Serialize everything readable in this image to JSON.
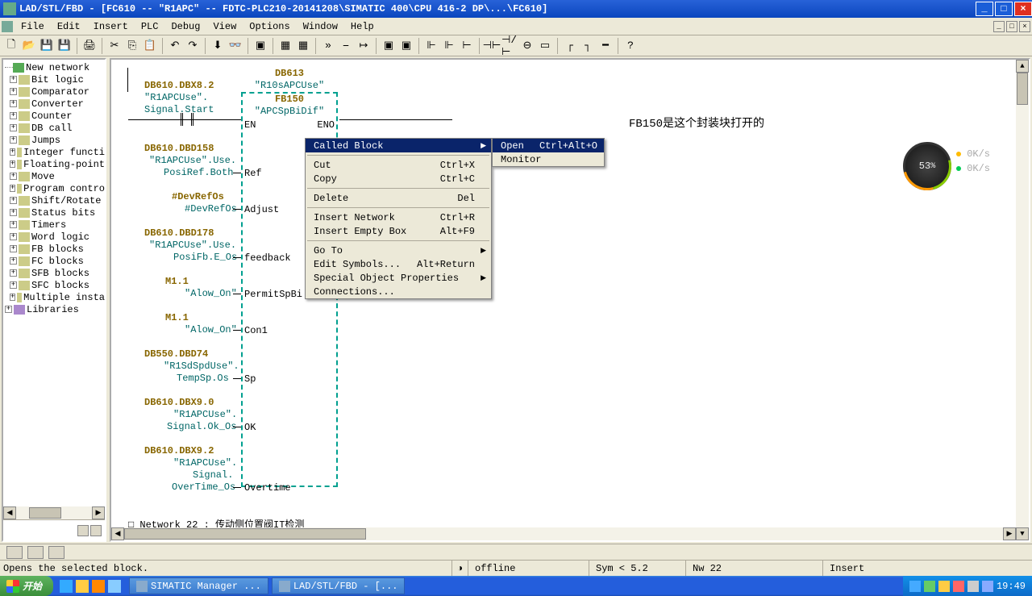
{
  "title": "LAD/STL/FBD  - [FC610 -- \"R1APC\" -- FDTC-PLC210-20141208\\SIMATIC 400\\CPU 416-2 DP\\...\\FC610]",
  "menu": {
    "file": "File",
    "edit": "Edit",
    "insert": "Insert",
    "plc": "PLC",
    "debug": "Debug",
    "view": "View",
    "options": "Options",
    "window": "Window",
    "help": "Help"
  },
  "tree": {
    "items": [
      "New network",
      "Bit logic",
      "Comparator",
      "Converter",
      "Counter",
      "DB call",
      "Jumps",
      "Integer functi",
      "Floating-point",
      "Move",
      "Program contro",
      "Shift/Rotate",
      "Status bits",
      "Timers",
      "Word logic",
      "FB blocks",
      "FC blocks",
      "SFB blocks",
      "SFC blocks",
      "Multiple insta"
    ],
    "libraries": "Libraries"
  },
  "block": {
    "db_header": "DB613",
    "db_name": "\"R10sAPCUse\"",
    "fb_header": "FB150",
    "fb_name": "\"APCSpBiDif\"",
    "en": "EN",
    "eno": "ENO",
    "p0_addr": "DB610.DBX8.2",
    "p0_sym": "\"R1APCUse\".",
    "p0_sym2": "Signal.Start",
    "p1_addr": "DB610.DBD158",
    "p1_sym": "\"R1APCUse\".Use.",
    "p1_sym2": "PosiRef.Both",
    "p1_port": "Ref",
    "p2_addr": "#DevRefOs",
    "p2_sym": "#DevRefOs",
    "p2_port": "Adjust",
    "p3_addr": "DB610.DBD178",
    "p3_sym": "\"R1APCUse\".Use.",
    "p3_sym2": "PosiFb.E_Os",
    "p3_port": "feedback",
    "p4_addr": "M1.1",
    "p4_sym": "\"Alow_On\"",
    "p4_port": "PermitSpBi",
    "p5_addr": "M1.1",
    "p5_sym": "\"Alow_On\"",
    "p5_port": "Con1",
    "p6_addr": "DB550.DBD74",
    "p6_sym": "\"R1SdSpdUse\".",
    "p6_sym2": "TempSp.Os",
    "p6_port": "Sp",
    "p7_addr": "DB610.DBX9.0",
    "p7_sym": "\"R1APCUse\".",
    "p7_sym2": "Signal.Ok_Os",
    "p7_port": "OK",
    "p8_addr": "DB610.DBX9.2",
    "p8_sym": "\"R1APCUse\".",
    "p8_sym2": "Signal.",
    "p8_sym3": "OverTime_Os",
    "p8_port": "Overtime",
    "footer": "□ Network 22 : 传动侧位置阀IT检测"
  },
  "ctx1": {
    "called": "Called Block",
    "cut": "Cut",
    "cut_sc": "Ctrl+X",
    "copy": "Copy",
    "copy_sc": "Ctrl+C",
    "delete": "Delete",
    "delete_sc": "Del",
    "insnet": "Insert Network",
    "insnet_sc": "Ctrl+R",
    "insbox": "Insert Empty Box",
    "insbox_sc": "Alt+F9",
    "goto": "Go To",
    "editsym": "Edit Symbols...",
    "editsym_sc": "Alt+Return",
    "sop": "Special Object Properties",
    "conn": "Connections..."
  },
  "ctx2": {
    "open": "Open",
    "open_sc": "Ctrl+Alt+O",
    "monitor": "Monitor"
  },
  "annotation": "FB150是这个封装块打开的",
  "cpu": {
    "pct": "53",
    "up": "0K/s",
    "dn": "0K/s"
  },
  "status": {
    "hint": "Opens the selected block.",
    "offline": "offline",
    "sym": "Sym < 5.2",
    "nw": "Nw 22",
    "insert": "Insert"
  },
  "taskbar": {
    "start": "开始",
    "t1": "SIMATIC Manager ...",
    "t2": "LAD/STL/FBD  - [...",
    "clock": "19:49"
  }
}
